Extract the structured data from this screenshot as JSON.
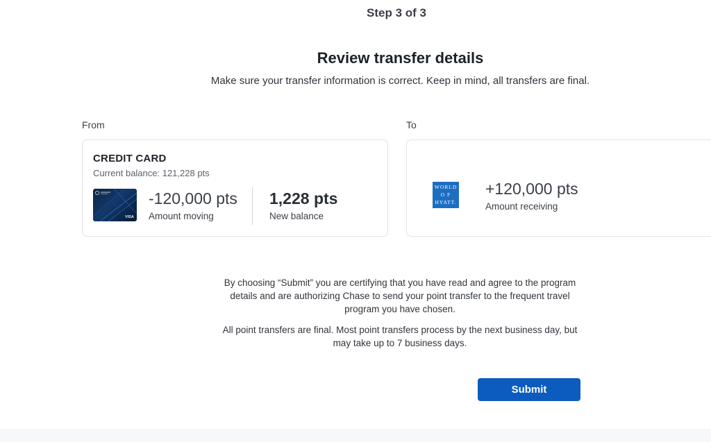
{
  "header": {
    "step": "Step 3 of 3",
    "title": "Review transfer details",
    "subtitle": "Make sure your transfer information is correct. Keep in mind, all transfers are final."
  },
  "from": {
    "label": "From",
    "card_name": "CREDIT CARD",
    "current_balance": "Current balance: 121,228 pts",
    "card_icon": "chase-sapphire-card-image",
    "amount_moving": "-120,000 pts",
    "amount_moving_label": "Amount moving",
    "new_balance": "1,228 pts",
    "new_balance_label": "New balance"
  },
  "to": {
    "label": "To",
    "program_logo_lines": [
      "WORLD",
      "O F",
      "HYATT."
    ],
    "amount_receiving": "+120,000 pts",
    "amount_receiving_label": "Amount receiving"
  },
  "disclaimer": {
    "certify": "By choosing “Submit” you are certifying that you have read and agree to the program details and are authorizing Chase to send your point transfer to the frequent travel program you have chosen.",
    "final": "All point transfers are final. Most point transfers process by the next business day, but may take up to 7 business days."
  },
  "actions": {
    "submit_label": "Submit"
  },
  "colors": {
    "primary": "#0b5cbe",
    "hyatt_blue": "#1c6ec2",
    "border": "#dfe3e8"
  }
}
